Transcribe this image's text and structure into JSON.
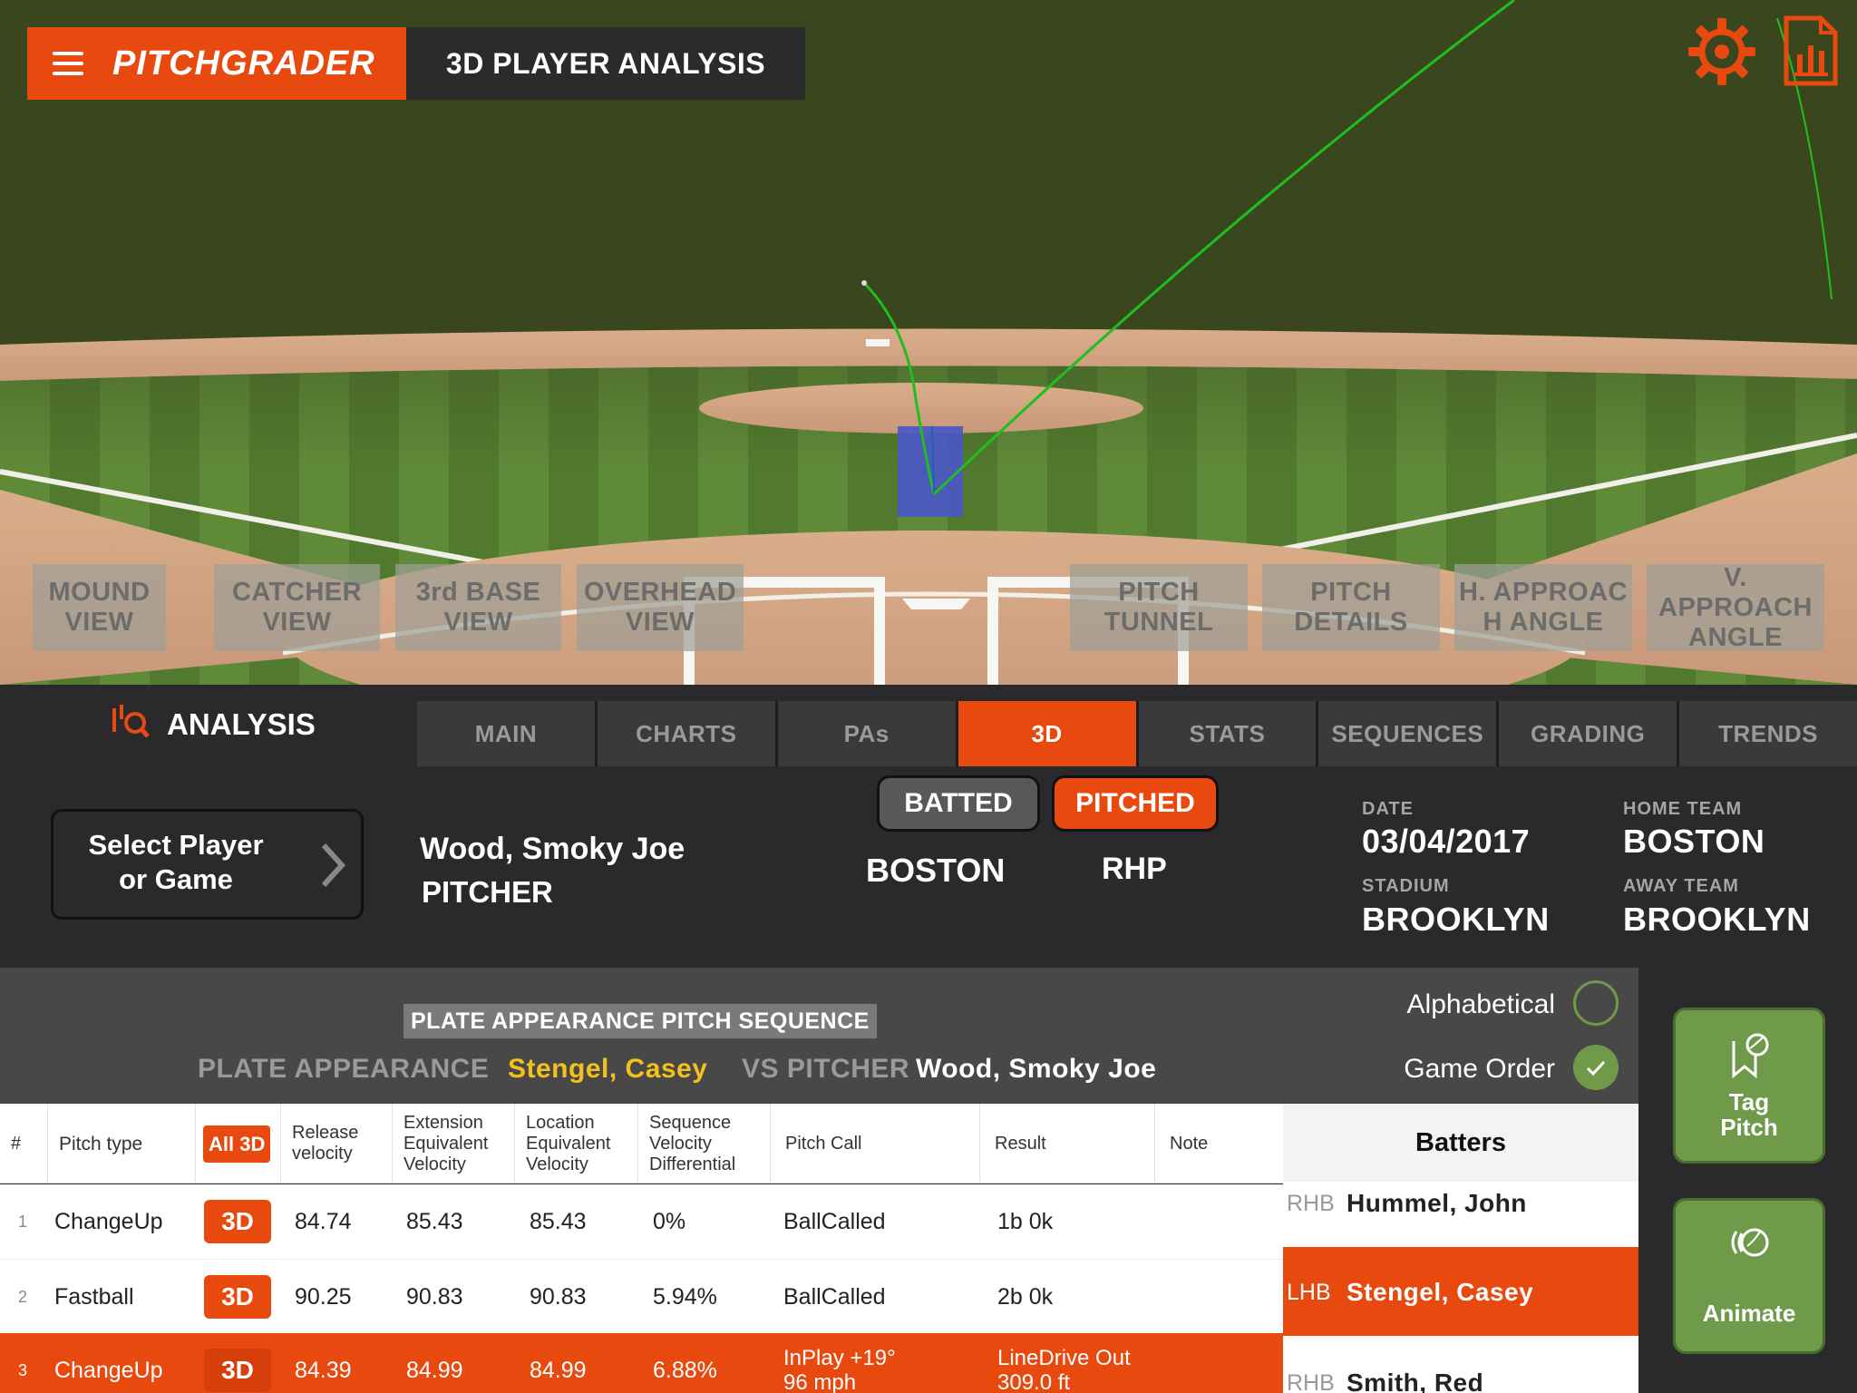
{
  "app": {
    "brand": "PITCHGRADER",
    "page_title": "3D PLAYER ANALYSIS"
  },
  "views": [
    {
      "label": "MOUND\nVIEW"
    },
    {
      "label": "CATCHER\nVIEW"
    },
    {
      "label": "3rd BASE\nVIEW"
    },
    {
      "label": "OVERHEAD\nVIEW"
    },
    {
      "label": "PITCH\nTUNNEL"
    },
    {
      "label": "PITCH\nDETAILS"
    },
    {
      "label": "H. APPROAC\nH ANGLE"
    },
    {
      "label": "V. APPROACH\nANGLE"
    }
  ],
  "analysis": {
    "title": "ANALYSIS",
    "tabs": [
      "MAIN",
      "CHARTS",
      "PAs",
      "3D",
      "STATS",
      "SEQUENCES",
      "GRADING",
      "TRENDS"
    ],
    "active_tab": "3D"
  },
  "player": {
    "select_label": "Select Player or Game",
    "name": "Wood, Smoky Joe",
    "role": "PITCHER",
    "toggle_batted": "BATTED",
    "toggle_pitched": "PITCHED",
    "team": "BOSTON",
    "hand": "RHP",
    "date_label": "DATE",
    "date": "03/04/2017",
    "stadium_label": "STADIUM",
    "stadium": "BROOKLYN",
    "home_label": "HOME TEAM",
    "home": "BOSTON",
    "away_label": "AWAY TEAM",
    "away": "BROOKLYN"
  },
  "sequence": {
    "title": "PLATE APPEARANCE PITCH SEQUENCE",
    "pa_label": "PLATE APPEARANCE",
    "batter": "Stengel, Casey",
    "vs_label": "VS PITCHER",
    "pitcher": "Wood, Smoky Joe"
  },
  "order": {
    "alphabetical": "Alphabetical",
    "game_order": "Game Order",
    "selected": "Game Order"
  },
  "side_buttons": {
    "tag": "Tag Pitch",
    "animate": "Animate"
  },
  "table": {
    "headers": {
      "num": "#",
      "pitch_type": "Pitch type",
      "all3d": "All 3D",
      "release": "Release\nvelocity",
      "extension": "Extension\nEquivalent\nVelocity",
      "location": "Location\nEquivalent\nVelocity",
      "sequence": "Sequence\nVelocity\nDifferential",
      "call": "Pitch Call",
      "result": "Result",
      "note": "Note"
    },
    "rows": [
      {
        "num": "1",
        "type": "ChangeUp",
        "btn": "3D",
        "release": "84.74",
        "ext": "85.43",
        "loc": "85.43",
        "seq": "0%",
        "call": "BallCalled",
        "result": "1b 0k",
        "note": ""
      },
      {
        "num": "2",
        "type": "Fastball",
        "btn": "3D",
        "release": "90.25",
        "ext": "90.83",
        "loc": "90.83",
        "seq": "5.94%",
        "call": "BallCalled",
        "result": "2b 0k",
        "note": ""
      },
      {
        "num": "3",
        "type": "ChangeUp",
        "btn": "3D",
        "release": "84.39",
        "ext": "84.99",
        "loc": "84.99",
        "seq": "6.88%",
        "call": "InPlay +19°\n96 mph",
        "result": "LineDrive Out\n309.0 ft",
        "note": ""
      }
    ],
    "selected_row": 3
  },
  "batters": {
    "header": "Batters",
    "items": [
      {
        "hand": "RHB",
        "name": "Hummel, John"
      },
      {
        "hand": "LHB",
        "name": "Stengel, Casey"
      },
      {
        "hand": "RHB",
        "name": "Smith, Red"
      }
    ],
    "selected": "Stengel, Casey"
  },
  "colors": {
    "accent": "#e8490f",
    "field_green": "#3b4a1f",
    "trajectory": "#1fbf1f",
    "panel": "#2a2a2c",
    "button_green": "#6f9a4a"
  }
}
